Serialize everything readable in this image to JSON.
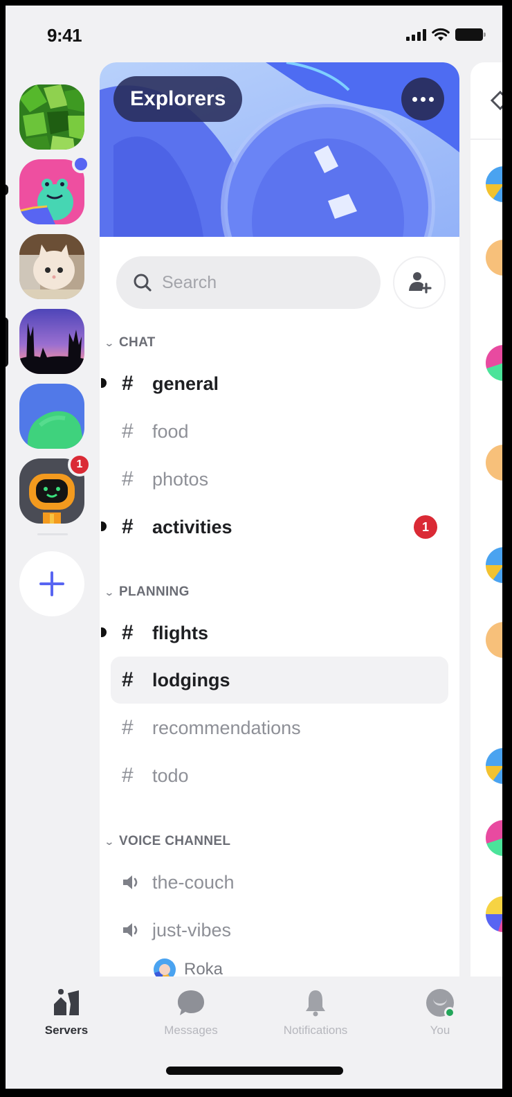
{
  "status_bar": {
    "time": "9:41"
  },
  "rail": {
    "servers": [
      {
        "name": "leaf-server",
        "unread": false,
        "selected": false
      },
      {
        "name": "frog-server",
        "unread": true,
        "badge": "dot",
        "selected": false
      },
      {
        "name": "cat-server",
        "unread": false,
        "selected": false
      },
      {
        "name": "sunset-server",
        "unread": false,
        "selected": true
      },
      {
        "name": "hill-server",
        "unread": false,
        "selected": false
      },
      {
        "name": "robot-server",
        "unread": false,
        "badge_count": "1",
        "selected": false
      }
    ],
    "add_server_label": "+"
  },
  "server": {
    "name": "Explorers",
    "more_label": "More options"
  },
  "search": {
    "placeholder": "Search",
    "value": ""
  },
  "categories": [
    {
      "label": "CHAT",
      "channels": [
        {
          "name": "general",
          "type": "text",
          "state": "unread"
        },
        {
          "name": "food",
          "type": "text",
          "state": "muted"
        },
        {
          "name": "photos",
          "type": "text",
          "state": "muted"
        },
        {
          "name": "activities",
          "type": "text",
          "state": "unread",
          "mentions": "1"
        }
      ]
    },
    {
      "label": "PLANNING",
      "channels": [
        {
          "name": "flights",
          "type": "text",
          "state": "unread"
        },
        {
          "name": "lodgings",
          "type": "text",
          "state": "selected"
        },
        {
          "name": "recommendations",
          "type": "text",
          "state": "muted"
        },
        {
          "name": "todo",
          "type": "text",
          "state": "muted"
        }
      ]
    },
    {
      "label": "VOICE CHANNEL",
      "channels": [
        {
          "name": "the-couch",
          "type": "voice",
          "state": "muted"
        },
        {
          "name": "just-vibes",
          "type": "voice",
          "state": "muted",
          "users": [
            "Roka"
          ]
        }
      ]
    }
  ],
  "tabs": [
    {
      "label": "Servers",
      "icon": "servers-icon",
      "active": true
    },
    {
      "label": "Messages",
      "icon": "messages-icon",
      "active": false
    },
    {
      "label": "Notifications",
      "icon": "bell-icon",
      "active": false
    },
    {
      "label": "You",
      "icon": "profile-icon",
      "active": false,
      "status": "online"
    }
  ],
  "colors": {
    "brand": "#5865f2",
    "mention_red": "#da2a35",
    "online_green": "#23a55a"
  }
}
